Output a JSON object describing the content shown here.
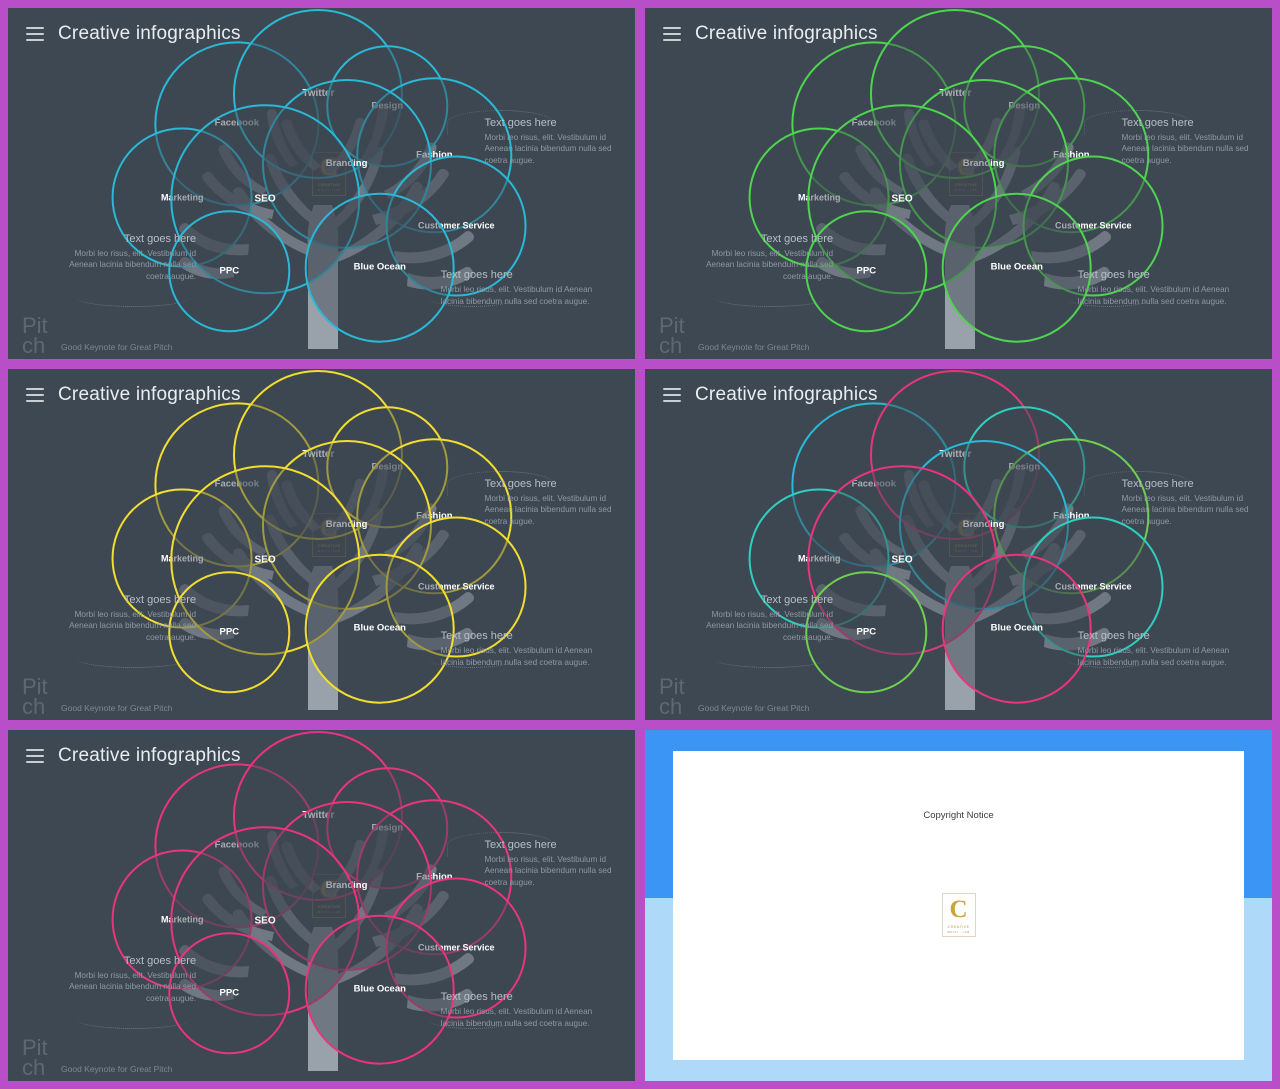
{
  "theme": {
    "frame_color": "#b84ec8",
    "slide_bg": "#3d4852",
    "tree_color": "#99a2ab",
    "title_text_color": "#e9edf0"
  },
  "header": {
    "title": "Creative infographics",
    "menu_icon": "hamburger-icon"
  },
  "footer": {
    "brand": "Pitch",
    "tagline": "Good Keynote for Great Pitch"
  },
  "bubble_labels": {
    "twitter": "Twitter",
    "design": "Design",
    "facebook": "Facebook",
    "fashion": "Fashion",
    "branding": "Branding",
    "marketing": "Marketing",
    "seo": "SEO",
    "customer_service": "Customer Service",
    "ppc": "PPC",
    "blue_ocean": "Blue Ocean"
  },
  "callouts": {
    "right_top": {
      "title": "Text goes here",
      "body": "Morbi leo risus, elit. Vestibulum id Aenean lacinia bibendum nulla sed coetra augue."
    },
    "left": {
      "title": "Text goes here",
      "body": "Morbi leo risus, elit. Vestibulum id Aenean lacinia bibendum nulla sed coetra augue."
    },
    "right_bottom": {
      "title": "Text goes here",
      "body": "Morbi leo risus, elit. Vestibulum id Aenean lacinia bibendum nulla sed coetra augue."
    }
  },
  "watermark": {
    "letter": "C",
    "line1": "CREATIVE",
    "line2": "MULTI - LAB"
  },
  "slides": [
    {
      "id": "slide-cyan",
      "accent": "#29b9d6",
      "colors": {
        "twitter": "#29b9d6",
        "design": "#29b9d6",
        "facebook": "#29b9d6",
        "fashion": "#29b9d6",
        "branding": "#29b9d6",
        "marketing": "#29b9d6",
        "seo": "#29b9d6",
        "customer_service": "#29b9d6",
        "ppc": "#29b9d6",
        "blue_ocean": "#29b9d6"
      }
    },
    {
      "id": "slide-green",
      "accent": "#4ed44e",
      "colors": {
        "twitter": "#4ed44e",
        "design": "#4ed44e",
        "facebook": "#4ed44e",
        "fashion": "#4ed44e",
        "branding": "#4ed44e",
        "marketing": "#4ed44e",
        "seo": "#4ed44e",
        "customer_service": "#4ed44e",
        "ppc": "#4ed44e",
        "blue_ocean": "#4ed44e"
      }
    },
    {
      "id": "slide-yellow",
      "accent": "#f2de2e",
      "colors": {
        "twitter": "#f2de2e",
        "design": "#f2de2e",
        "facebook": "#f2de2e",
        "fashion": "#f2de2e",
        "branding": "#f2de2e",
        "marketing": "#f2de2e",
        "seo": "#f2de2e",
        "customer_service": "#f2de2e",
        "ppc": "#f2de2e",
        "blue_ocean": "#f2de2e"
      }
    },
    {
      "id": "slide-mixed",
      "accent": "#e8357b",
      "colors": {
        "twitter": "#e8357b",
        "design": "#2fcfc0",
        "facebook": "#29b9d6",
        "fashion": "#6ed04e",
        "branding": "#29b9d6",
        "marketing": "#2fcfc0",
        "seo": "#e8357b",
        "customer_service": "#2fcfc0",
        "ppc": "#6ed04e",
        "blue_ocean": "#e8357b"
      }
    },
    {
      "id": "slide-pink",
      "accent": "#e8357b",
      "colors": {
        "twitter": "#e8357b",
        "design": "#e8357b",
        "facebook": "#e8357b",
        "fashion": "#e8357b",
        "branding": "#e8357b",
        "marketing": "#e8357b",
        "seo": "#e8357b",
        "customer_service": "#e8357b",
        "ppc": "#e8357b",
        "blue_ocean": "#e8357b"
      }
    }
  ],
  "copyright_slide": {
    "title": "Copyright Notice",
    "band_top_color": "#3b95f5",
    "band_bottom_color": "#afd9f9",
    "page_color": "#ffffff"
  }
}
